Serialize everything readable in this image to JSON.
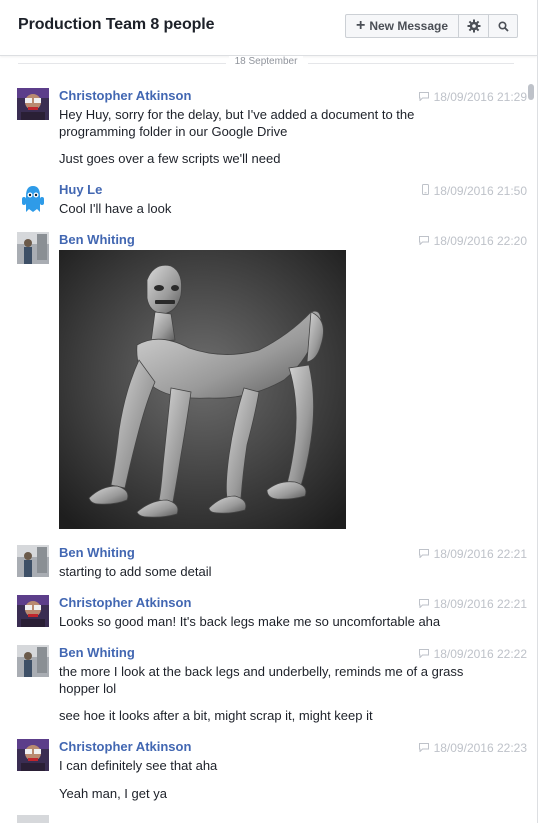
{
  "header": {
    "title": "Production Team 8 people",
    "new_message_label": "New Message"
  },
  "date_divider": "18 September",
  "messages": [
    {
      "sender": "Christopher Atkinson",
      "time": "18/09/2016 21:29",
      "source": "chat",
      "lines": [
        "Hey Huy, sorry for the delay, but I've added a document to the programming folder in our Google Drive",
        "Just goes over a few scripts we'll need"
      ]
    },
    {
      "sender": "Huy Le",
      "time": "18/09/2016 21:50",
      "source": "mobile",
      "lines": [
        "Cool I'll have a look"
      ]
    },
    {
      "sender": "Ben Whiting",
      "time": "18/09/2016 22:20",
      "source": "chat",
      "lines": []
    },
    {
      "sender": "Ben Whiting",
      "time": "18/09/2016 22:21",
      "source": "chat",
      "lines": [
        "starting to add some detail"
      ]
    },
    {
      "sender": "Christopher Atkinson",
      "time": "18/09/2016 22:21",
      "source": "chat",
      "lines": [
        "Looks so good man! It's back legs make me so uncomfortable aha"
      ]
    },
    {
      "sender": "Ben Whiting",
      "time": "18/09/2016 22:22",
      "source": "chat",
      "lines": [
        "the more I look at the back legs and underbelly, reminds me of a grass hopper lol",
        "see hoe it looks after a bit, might scrap it, might keep it"
      ]
    },
    {
      "sender": "Christopher Atkinson",
      "time": "18/09/2016 22:23",
      "source": "chat",
      "lines": [
        "I can definitely see that aha",
        "Yeah man, I get ya"
      ]
    }
  ],
  "icons": {
    "add": "plus-icon",
    "settings": "gear-icon",
    "search": "search-icon",
    "chat_source": "chat-bubble-icon",
    "mobile_source": "mobile-phone-icon"
  },
  "colors": {
    "sender_name": "#4267b2",
    "timestamp": "#bec2c9",
    "text": "#1d2129",
    "divider": "#dddfe2"
  }
}
